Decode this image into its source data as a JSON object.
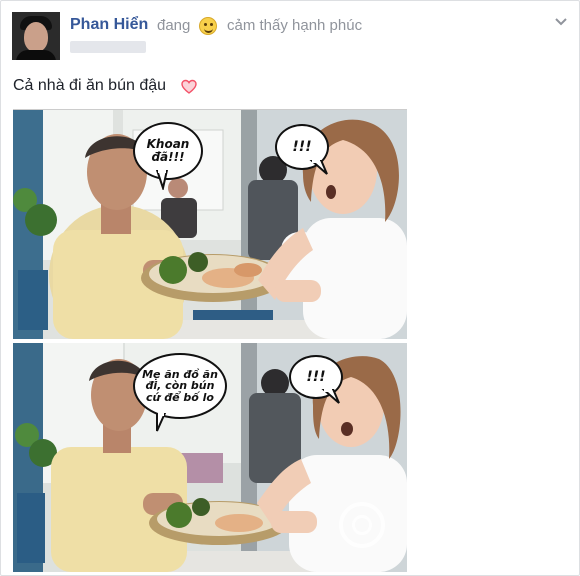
{
  "post": {
    "author_name": "Phan Hiển",
    "status_prefix": "đang",
    "feeling_icon": "smile-emoji-icon",
    "feeling_text": "cảm thấy hạnh phúc",
    "caption": "Cả nhà đi ăn bún đậu",
    "caption_icon": "heart-icon",
    "menu_icon": "chevron-down-icon"
  },
  "photo": {
    "top_panel": {
      "boy_bubble": "Khoan đã!!!",
      "woman_bubble": "!!!"
    },
    "bottom_panel": {
      "boy_bubble": "Mẹ ăn đồ ăn đi, còn bún cứ để bố lo",
      "woman_bubble": "!!!"
    }
  },
  "colors": {
    "author": "#365899",
    "secondary_text": "#90949c",
    "heart": "#f35369"
  }
}
